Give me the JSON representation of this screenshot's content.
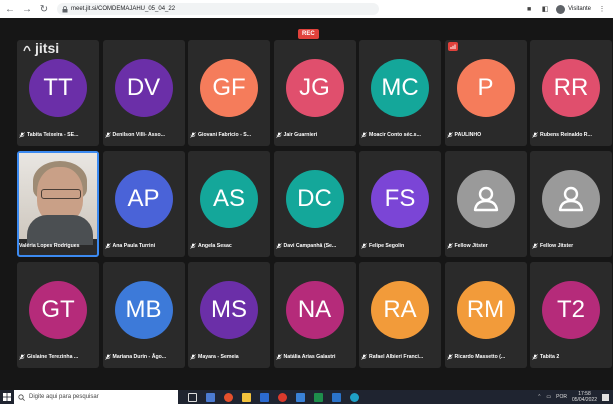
{
  "browser": {
    "url": "meet.jit.si/COMDEMAJAHU_05_04_22",
    "profile_label": "Visitante"
  },
  "meeting": {
    "logo_text": "jitsi",
    "rec_label": "REC"
  },
  "participants": [
    {
      "initials": "TT",
      "name": "Tabita Teixeira - SE...",
      "color": "#6b2fa8"
    },
    {
      "initials": "DV",
      "name": "Denilson Villi- Asso...",
      "color": "#6b2fa8"
    },
    {
      "initials": "GF",
      "name": "Giovani Fabricio - S...",
      "color": "#f57c5b"
    },
    {
      "initials": "JG",
      "name": "Jair Guarnieri",
      "color": "#e04f6d"
    },
    {
      "initials": "MC",
      "name": "Moacir Conto séc.s...",
      "color": "#14a79a"
    },
    {
      "initials": "P",
      "name": "PAULINHO",
      "color": "#f57c5b",
      "signal": true
    },
    {
      "initials": "RR",
      "name": "Rubens Reinaldo R...",
      "color": "#e04f6d"
    },
    {
      "initials": "",
      "name": "Valéria Lopes Rodrigues",
      "color": "",
      "video": true
    },
    {
      "initials": "AP",
      "name": "Ana Paula Turrini",
      "color": "#4a63d8"
    },
    {
      "initials": "AS",
      "name": "Angela Sesac",
      "color": "#14a79a"
    },
    {
      "initials": "DC",
      "name": "Davi Campanhã (Se...",
      "color": "#14a79a"
    },
    {
      "initials": "FS",
      "name": "Felipe Segolin",
      "color": "#7b45d6"
    },
    {
      "initials": "",
      "name": "Fellow Jitster",
      "color": "",
      "generic": true
    },
    {
      "initials": "",
      "name": "Fellow Jitster",
      "color": "",
      "generic": true
    },
    {
      "initials": "GT",
      "name": "Gislaine Terezinha ...",
      "color": "#b52b7a"
    },
    {
      "initials": "MB",
      "name": "Mariana Durin - Âgo...",
      "color": "#3d7ad9"
    },
    {
      "initials": "MS",
      "name": "Mayara - Semeia",
      "color": "#6b2fa8"
    },
    {
      "initials": "NA",
      "name": "Natália Arias Galastri",
      "color": "#b52b7a"
    },
    {
      "initials": "RA",
      "name": "Rafael Albieri Franci...",
      "color": "#f29b3a"
    },
    {
      "initials": "RM",
      "name": "Ricardo Massetto (...",
      "color": "#f29b3a"
    },
    {
      "initials": "T2",
      "name": "Tabita 2",
      "color": "#b52b7a"
    }
  ],
  "taskbar": {
    "search_placeholder": "Digite aqui para pesquisar",
    "lang": "POR",
    "time": "17:58",
    "date": "05/04/2022"
  }
}
